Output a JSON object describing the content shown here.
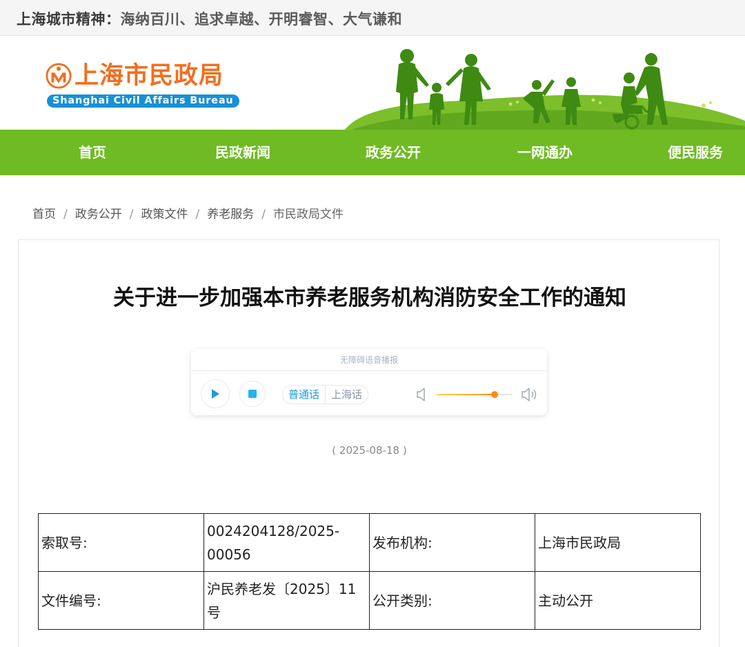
{
  "motto": {
    "lead": "上海城市精神：",
    "text": "海纳百川、追求卓越、开明睿智、大气谦和"
  },
  "logo": {
    "cn": "上海市民政局",
    "en": "Shanghai Civil Affairs Bureau"
  },
  "nav": {
    "items": [
      {
        "label": "首页"
      },
      {
        "label": "民政新闻"
      },
      {
        "label": "政务公开"
      },
      {
        "label": "一网通办"
      },
      {
        "label": "便民服务"
      }
    ]
  },
  "breadcrumb": {
    "items": [
      "首页",
      "政务公开",
      "政策文件",
      "养老服务"
    ],
    "current": "市民政局文件",
    "separator": "/"
  },
  "article": {
    "title": "关于进一步加强本市养老服务机构消防安全工作的通知",
    "date": "( 2025-08-18 )"
  },
  "player": {
    "header": "无障碍语音播报",
    "lang_mandarin": "普通话",
    "lang_shanghainese": "上海话",
    "volume": 0.76,
    "accent": "#1f9bd9",
    "volume_color": "#ff8a1a",
    "icons": [
      "play-icon",
      "stop-icon",
      "volume-low-icon",
      "volume-high-icon"
    ]
  },
  "meta": {
    "index_label": "索取号:",
    "index_value": "0024204128/2025-00056",
    "publisher_label": "发布机构:",
    "publisher_value": "上海市民政局",
    "docno_label": "文件编号:",
    "docno_value": "沪民养老发〔2025〕11号",
    "category_label": "公开类别:",
    "category_value": "主动公开"
  },
  "colors": {
    "nav_green": "#6fbb23",
    "logo_orange": "#f26e1f",
    "logo_blue": "#1890d6"
  }
}
